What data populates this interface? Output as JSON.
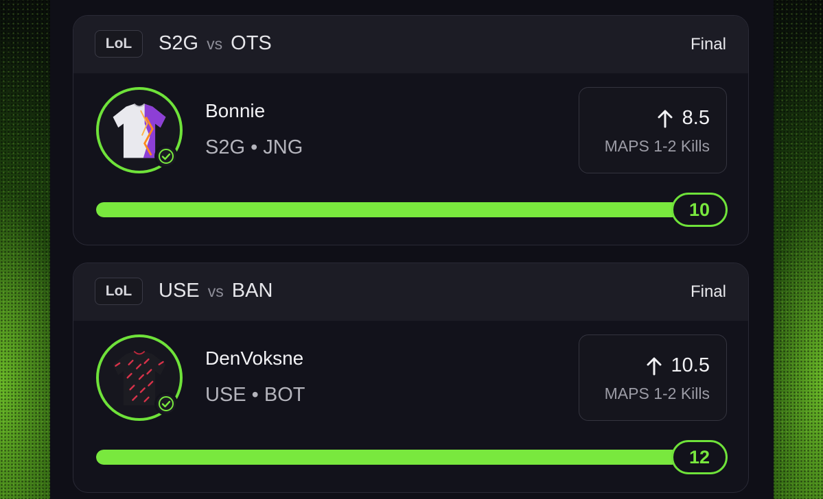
{
  "accent": "#79e83e",
  "cards": [
    {
      "game": "LoL",
      "team_a": "S2G",
      "vs": "vs",
      "team_b": "OTS",
      "status": "Final",
      "player": "Bonnie",
      "meta": "S2G • JNG",
      "direction_icon": "arrow-up-icon",
      "line": "8.5",
      "stat": "MAPS 1-2 Kills",
      "result": "10",
      "progress_fraction": 1.0
    },
    {
      "game": "LoL",
      "team_a": "USE",
      "vs": "vs",
      "team_b": "BAN",
      "status": "Final",
      "player": "DenVoksne",
      "meta": "USE • BOT",
      "direction_icon": "arrow-up-icon",
      "line": "10.5",
      "stat": "MAPS 1-2 Kills",
      "result": "12",
      "progress_fraction": 1.0
    }
  ]
}
